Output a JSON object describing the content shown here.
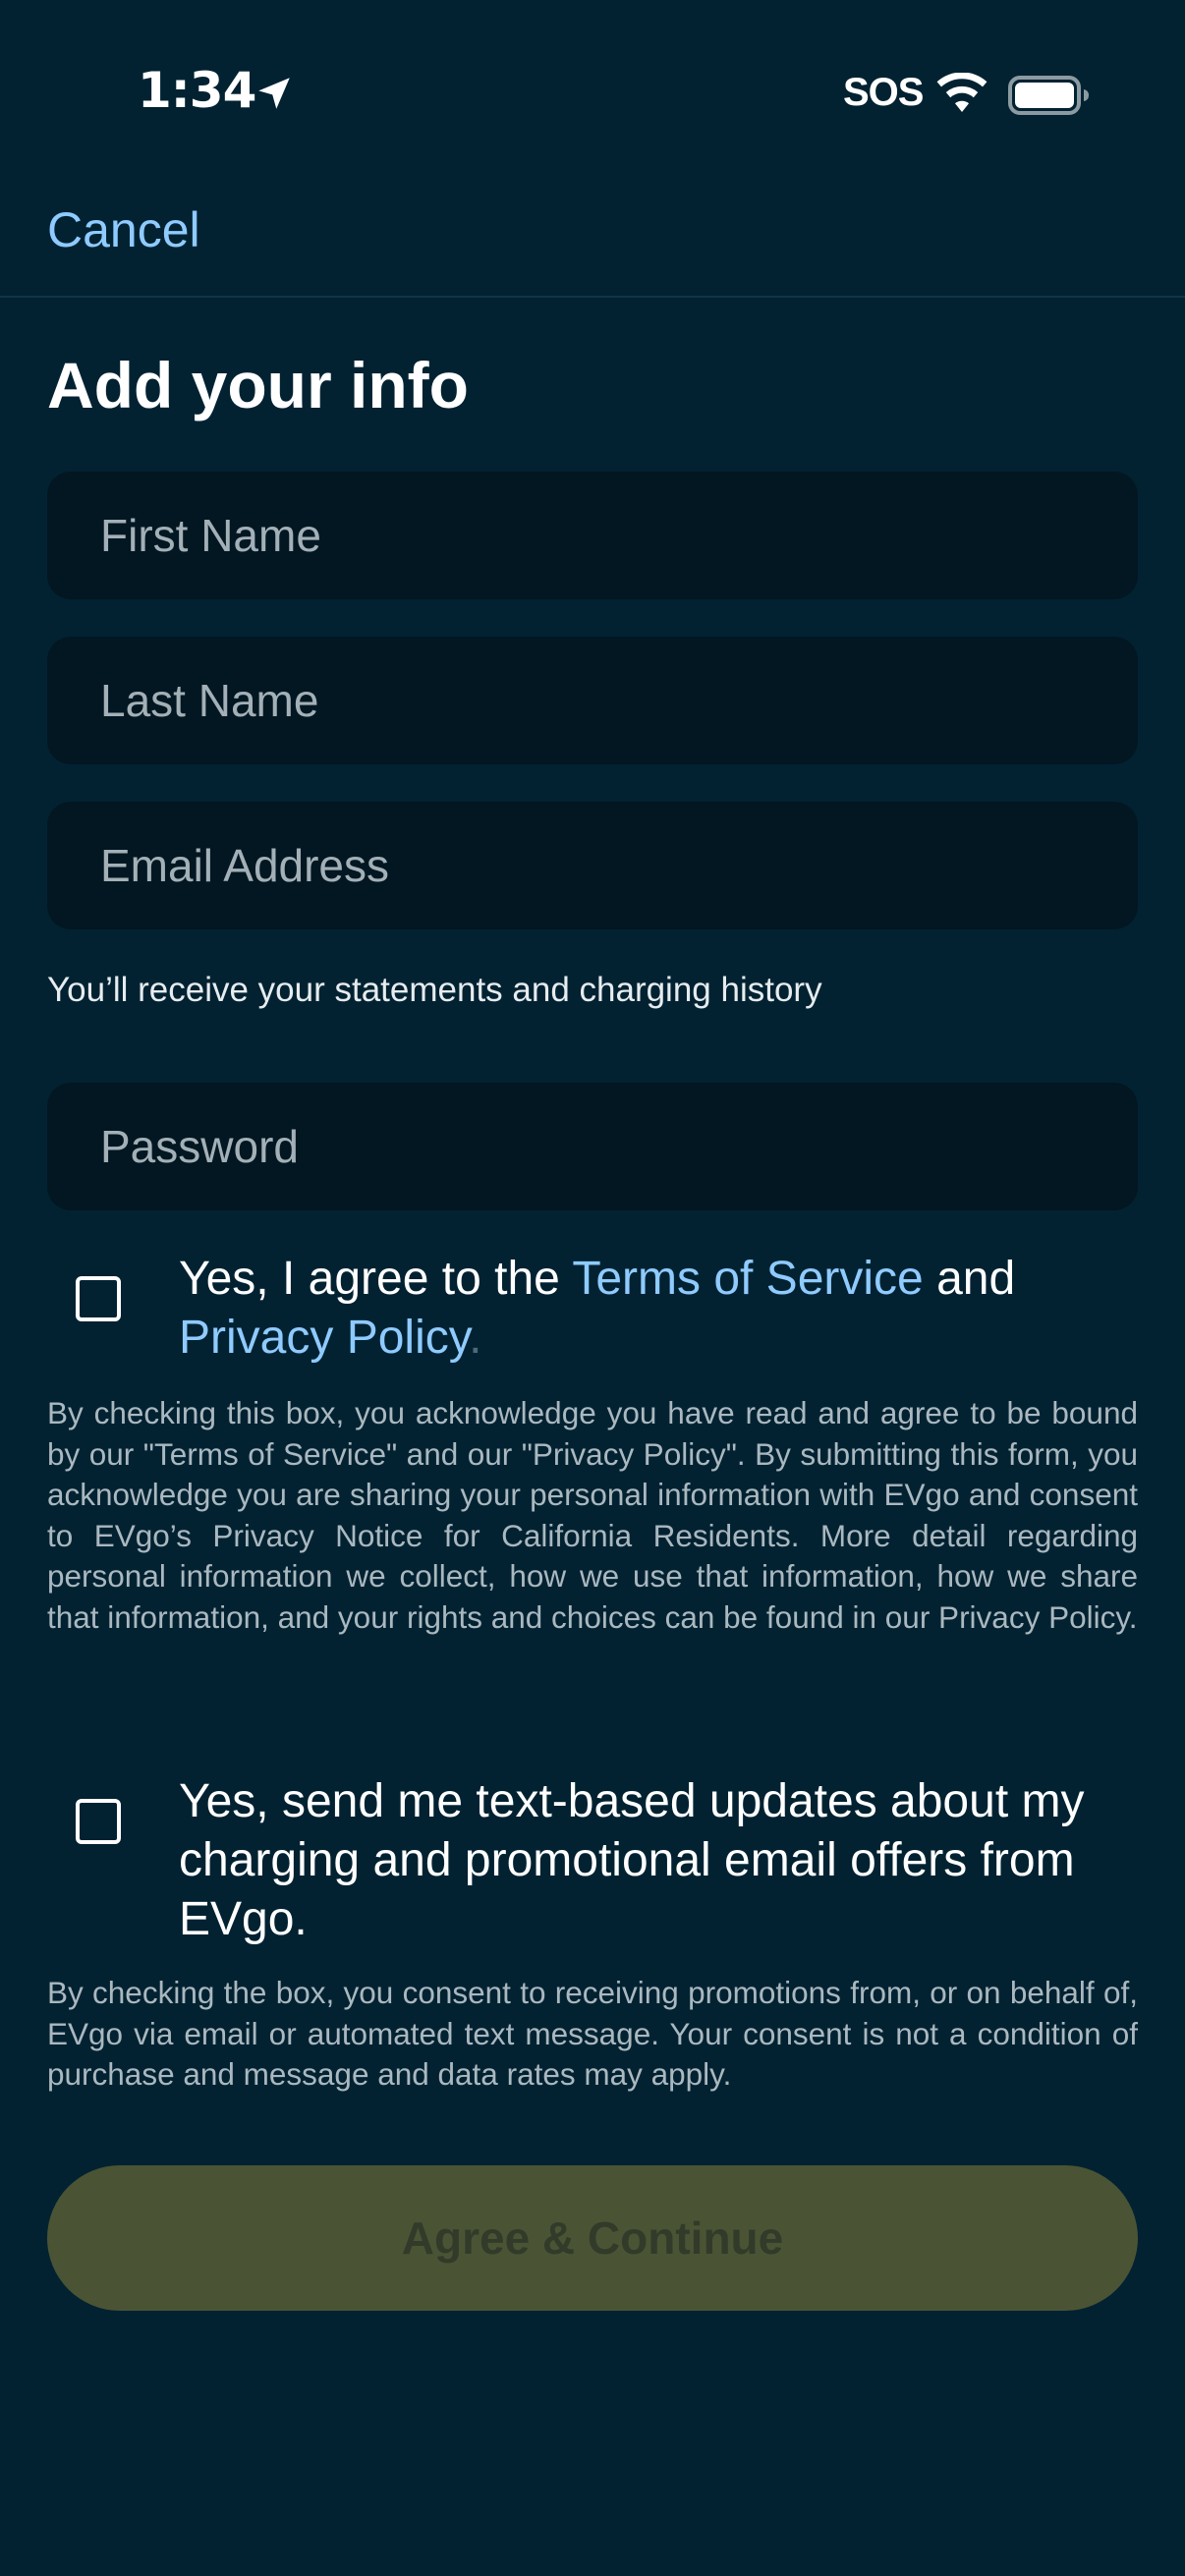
{
  "status_bar": {
    "time": "1:34",
    "carrier_text": "SOS",
    "icons": [
      "location-arrow-icon",
      "wifi-icon",
      "battery-icon"
    ]
  },
  "nav": {
    "cancel_label": "Cancel"
  },
  "page": {
    "title": "Add your info"
  },
  "form": {
    "first_name": {
      "placeholder": "First Name",
      "value": ""
    },
    "last_name": {
      "placeholder": "Last Name",
      "value": ""
    },
    "email": {
      "placeholder": "Email Address",
      "value": ""
    },
    "email_hint": "You’ll receive your statements and charging history",
    "password": {
      "placeholder": "Password",
      "value": ""
    }
  },
  "terms_consent": {
    "checked": false,
    "text_prefix": "Yes, I agree to the ",
    "terms_link": "Terms of Service",
    "text_middle": " and",
    "privacy_link": "Privacy Policy",
    "text_suffix": ".",
    "fine_print": "By checking this box, you acknowledge you have read and agree to be bound by our \"Terms of Service\" and our \"Privacy Policy\". By submitting this form, you acknowledge you are sharing your personal information with EVgo and consent to EVgo’s Privacy Notice for California Residents. More detail regarding personal information we collect, how we use that information, how we share that information, and your rights and choices can be found in our Privacy Policy."
  },
  "marketing_consent": {
    "checked": false,
    "label": "Yes, send me text-based updates about my charging and promotional email offers from EVgo.",
    "fine_print": "By checking the box, you consent to receiving promotions from, or on behalf of, EVgo via email or automated text message. Your consent is not a condition of purchase and message and data rates may apply."
  },
  "cta": {
    "label": "Agree & Continue",
    "enabled": false
  },
  "colors": {
    "background": "#022232",
    "field_background": "#021721",
    "link": "#8fcbff",
    "cta_disabled_bg": "#4a5434",
    "cta_disabled_text": "#323b2a"
  }
}
